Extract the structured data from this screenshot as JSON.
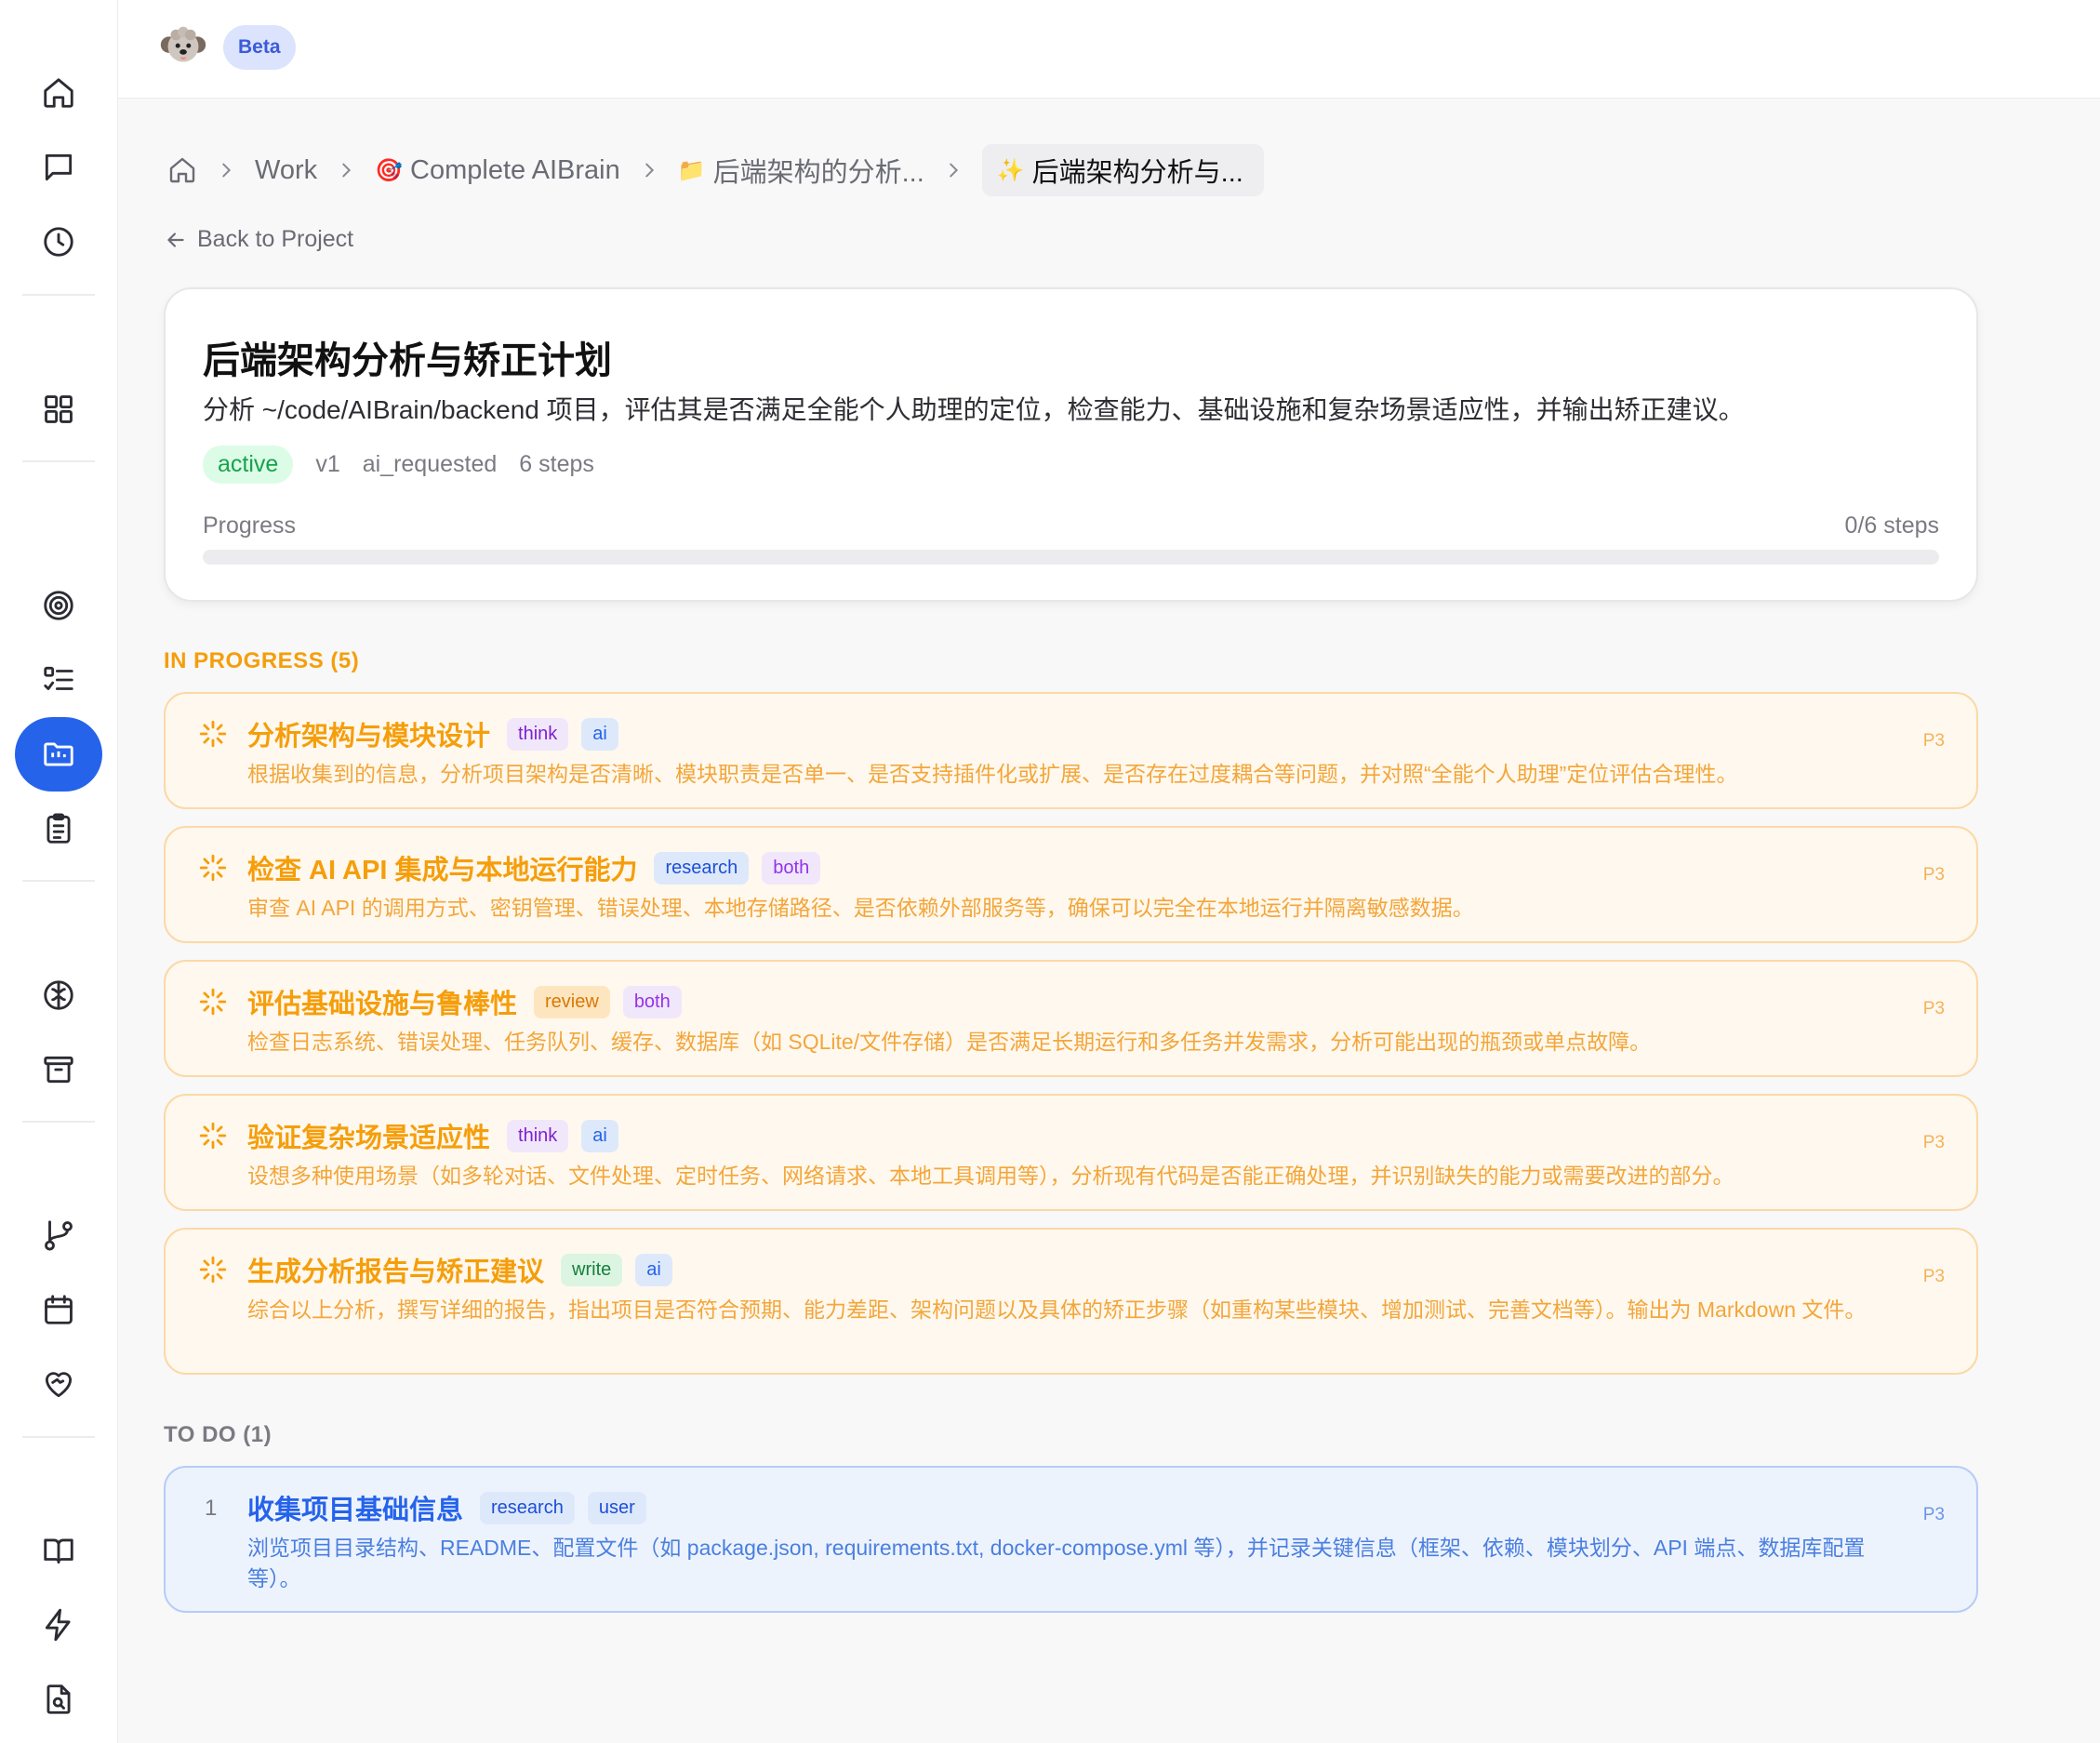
{
  "topbar": {
    "avatar_alt": "dog avatar",
    "badge": "Beta"
  },
  "sidebar": {
    "items": [
      {
        "name": "home-icon",
        "active": false
      },
      {
        "name": "chat-icon",
        "active": false
      },
      {
        "name": "clock-icon",
        "active": false
      },
      {
        "name": "dashboard-icon",
        "active": false
      },
      {
        "name": "target-icon",
        "active": false
      },
      {
        "name": "checklist-icon",
        "active": false
      },
      {
        "name": "projects-icon",
        "active": true
      },
      {
        "name": "clipboard-icon",
        "active": false
      },
      {
        "name": "brain-icon",
        "active": false
      },
      {
        "name": "archive-icon",
        "active": false
      },
      {
        "name": "branch-icon",
        "active": false
      },
      {
        "name": "calendar-icon",
        "active": false
      },
      {
        "name": "heart-handshake-icon",
        "active": false
      },
      {
        "name": "book-icon",
        "active": false
      },
      {
        "name": "lightning-icon",
        "active": false
      },
      {
        "name": "file-search-icon",
        "active": false
      }
    ]
  },
  "breadcrumb": {
    "items": [
      {
        "label": "Work",
        "emoji": ""
      },
      {
        "label": "Complete AIBrain",
        "emoji": "🎯"
      },
      {
        "label": "后端架构的分析...",
        "emoji": "📁"
      },
      {
        "label": "后端架构分析与...",
        "emoji": "✨"
      }
    ]
  },
  "back_link": "Back to Project",
  "plan": {
    "title": "后端架构分析与矫正计划",
    "description": "分析 ~/code/AIBrain/backend 项目，评估其是否满足全能个人助理的定位，检查能力、基础设施和复杂场景适应性，并输出矫正建议。",
    "status": "active",
    "version": "v1",
    "source": "ai_requested",
    "steps_label": "6 steps",
    "progress_label": "Progress",
    "progress_count": "0/6 steps",
    "progress_fraction": 0
  },
  "sections": {
    "in_progress": {
      "title": "IN PROGRESS (5)",
      "tasks": [
        {
          "title": "分析架构与模块设计",
          "tags": [
            "think",
            "ai"
          ],
          "desc": "根据收集到的信息，分析项目架构是否清晰、模块职责是否单一、是否支持插件化或扩展、是否存在过度耦合等问题，并对照“全能个人助理”定位评估合理性。",
          "priority": "P3"
        },
        {
          "title": "检查 AI API 集成与本地运行能力",
          "tags": [
            "research",
            "both"
          ],
          "desc": "审查 AI API 的调用方式、密钥管理、错误处理、本地存储路径、是否依赖外部服务等，确保可以完全在本地运行并隔离敏感数据。",
          "priority": "P3"
        },
        {
          "title": "评估基础设施与鲁棒性",
          "tags": [
            "review",
            "both"
          ],
          "desc": "检查日志系统、错误处理、任务队列、缓存、数据库（如 SQLite/文件存储）是否满足长期运行和多任务并发需求，分析可能出现的瓶颈或单点故障。",
          "priority": "P3"
        },
        {
          "title": "验证复杂场景适应性",
          "tags": [
            "think",
            "ai"
          ],
          "desc": "设想多种使用场景（如多轮对话、文件处理、定时任务、网络请求、本地工具调用等），分析现有代码是否能正确处理，并识别缺失的能力或需要改进的部分。",
          "priority": "P3"
        },
        {
          "title": "生成分析报告与矫正建议",
          "tags": [
            "write",
            "ai"
          ],
          "desc": "综合以上分析，撰写详细的报告，指出项目是否符合预期、能力差距、架构问题以及具体的矫正步骤（如重构某些模块、增加测试、完善文档等）。输出为 Markdown 文件。",
          "priority": "P3"
        }
      ]
    },
    "todo": {
      "title": "TO DO (1)",
      "tasks": [
        {
          "number": "1",
          "title": "收集项目基础信息",
          "tags": [
            "research",
            "user"
          ],
          "desc": "浏览项目目录结构、README、配置文件（如 package.json, requirements.txt, docker-compose.yml 等），并记录关键信息（框架、依赖、模块划分、API 端点、数据库配置等）。",
          "priority": "P3"
        }
      ]
    }
  }
}
